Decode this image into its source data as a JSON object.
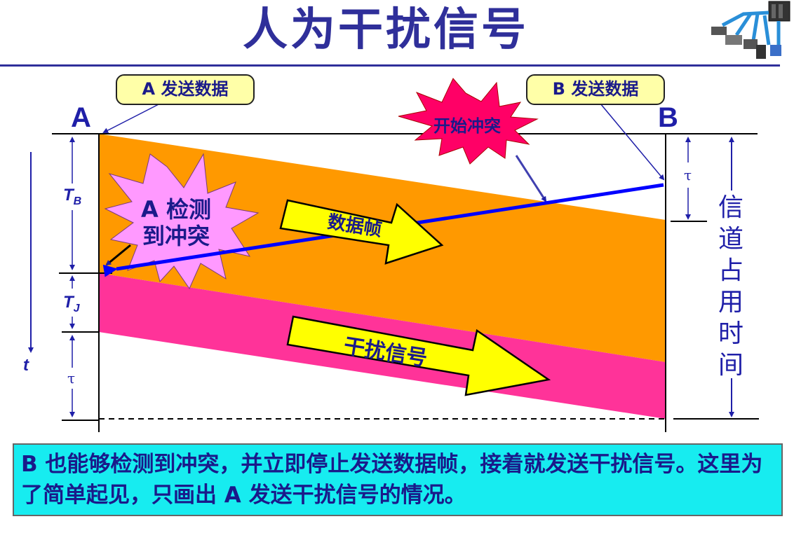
{
  "title": "人为干扰信号",
  "icons": {
    "top_right": "network-topology-icon"
  },
  "callouts": {
    "a_send": "A 发送数据",
    "b_send": "B 发送数据"
  },
  "stations": {
    "a": "A",
    "b": "B"
  },
  "stars": {
    "collision_start": "开始冲突",
    "a_detect_line1": "A 检测",
    "a_detect_line2": "到冲突"
  },
  "arrows": {
    "data_frame": "数据帧",
    "jam_signal": "干扰信号"
  },
  "left_axis": {
    "tb_main": "T",
    "tb_sub": "B",
    "tj_main": "T",
    "tj_sub": "J",
    "tau": "τ",
    "time": "t"
  },
  "right_axis": {
    "tau": "τ",
    "occupancy": "信道占用时间"
  },
  "note": "B 也能够检测到冲突，并立即停止发送数据帧，接着就发送干扰信号。这里为了简单起见，只画出 A 发送干扰信号的情况。",
  "colors": {
    "title": "#2f2f9a",
    "data_band": "#ff9900",
    "jam_band": "#ff3399",
    "arrow_fill": "#ffff00",
    "line_blue": "#0000ff",
    "collision_star": "#ff0066",
    "detect_star": "#ff99ff",
    "note_bg": "#17ecf0",
    "callout_bg": "#ffffa8"
  }
}
